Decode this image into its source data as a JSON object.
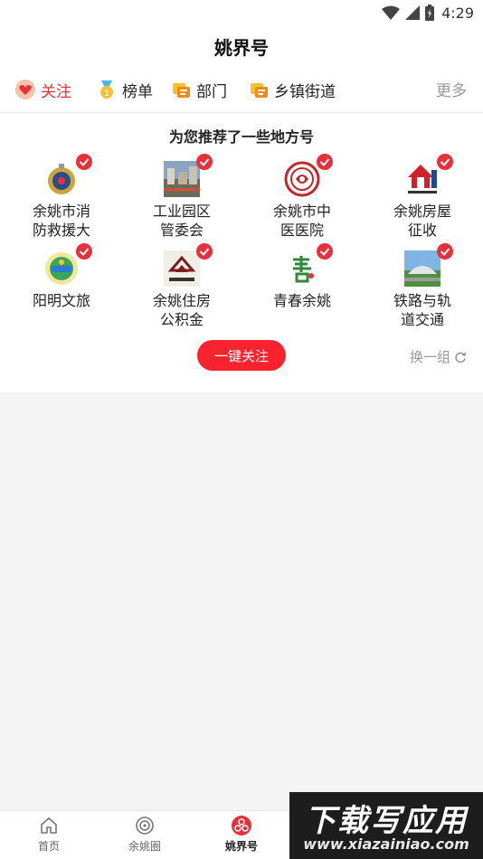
{
  "status_bar": {
    "time": "4:29"
  },
  "header": {
    "title": "姚界号"
  },
  "tabs": [
    {
      "label": "关注",
      "icon": "heart-badge-icon",
      "active": true
    },
    {
      "label": "榜单",
      "icon": "medal-icon",
      "active": false
    },
    {
      "label": "部门",
      "icon": "flag-chat-icon",
      "active": false
    },
    {
      "label": "乡镇街道",
      "icon": "flag-chat-icon",
      "active": false
    }
  ],
  "tabs_more": "更多",
  "recommend": {
    "title": "为您推荐了一些地方号",
    "items": [
      {
        "name": "余姚市消\n防救援大",
        "logo": "fire-rescue-emblem-icon",
        "selected": true
      },
      {
        "name": "工业园区\n管委会",
        "logo": "industrial-park-photo-icon",
        "selected": true
      },
      {
        "name": "余姚市中\n医医院",
        "logo": "tcm-hospital-seal-icon",
        "selected": true
      },
      {
        "name": "余姚房屋\n征收",
        "logo": "government-house-icon",
        "selected": true
      },
      {
        "name": "阳明文旅",
        "logo": "culture-tourism-emblem-icon",
        "selected": true
      },
      {
        "name": "余姚住房\n公积金",
        "logo": "housing-fund-logo-icon",
        "selected": true
      },
      {
        "name": "青春余姚",
        "logo": "youth-calligraphy-icon",
        "selected": true
      },
      {
        "name": "铁路与轨\n道交通",
        "logo": "railway-station-photo-icon",
        "selected": true
      }
    ],
    "follow_all_label": "一键关注",
    "refresh_label": "换一组"
  },
  "bottom_nav": [
    {
      "label": "首页",
      "icon": "home-icon",
      "active": false
    },
    {
      "label": "余姚圈",
      "icon": "circle-target-icon",
      "active": false
    },
    {
      "label": "姚界号",
      "icon": "yaojie-logo-icon",
      "active": true
    }
  ],
  "watermark": {
    "line1": "下载写应用",
    "line2": "www.xiazainiao.com"
  },
  "colors": {
    "accent": "#e8303a",
    "button": "#f8232f"
  }
}
